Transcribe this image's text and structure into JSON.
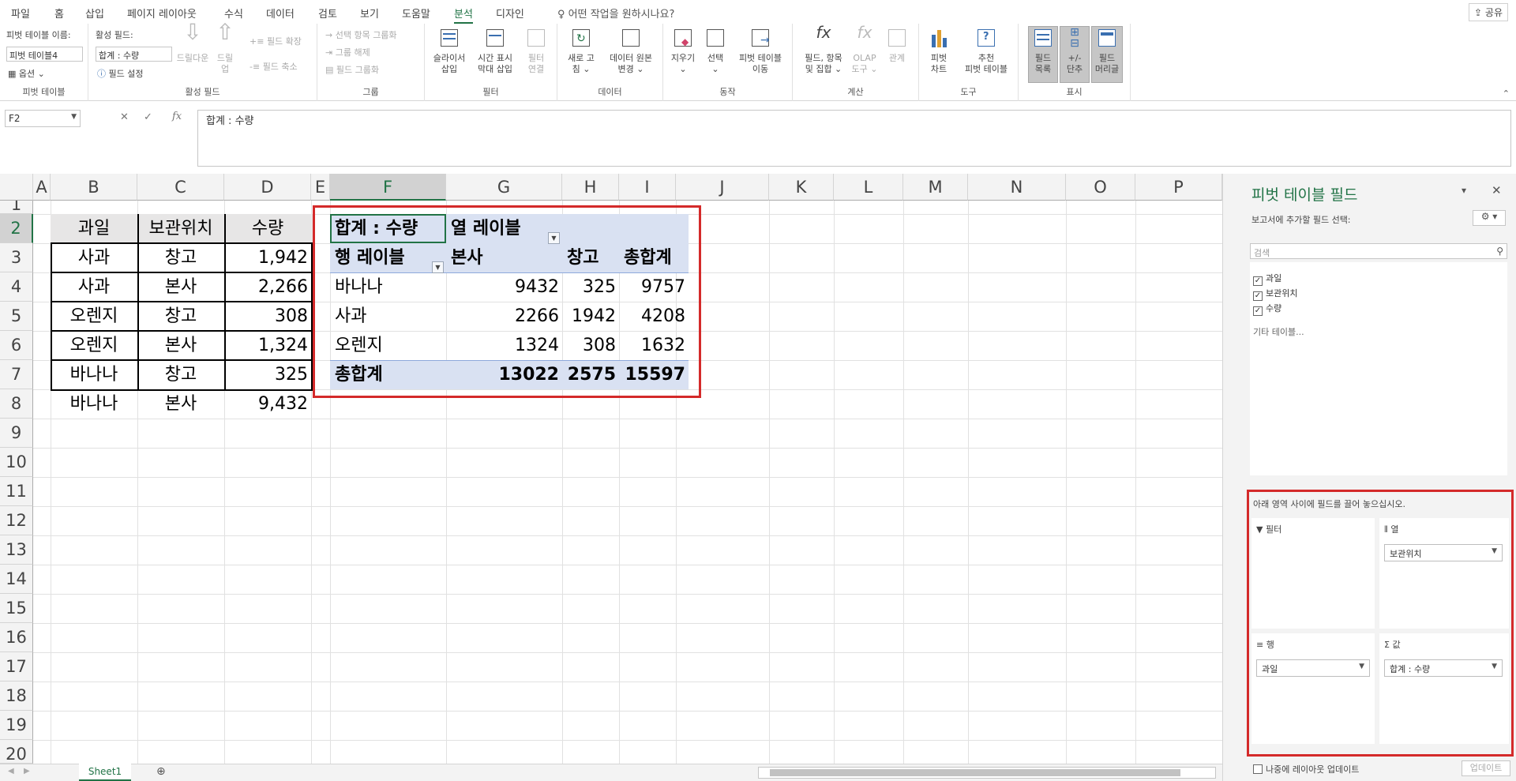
{
  "menu": {
    "items": [
      "파일",
      "홈",
      "삽입",
      "페이지 레이아웃",
      "수식",
      "데이터",
      "검토",
      "보기",
      "도움말",
      "분석",
      "디자인"
    ],
    "tell_me": "어떤 작업을 원하시나요?",
    "share": "공유"
  },
  "ribbon": {
    "pivot": {
      "name_label": "피벗 테이블 이름:",
      "name_value": "피벗 테이블4",
      "options": "옵션",
      "group": "피벗 테이블"
    },
    "active_field": {
      "label": "활성 필드:",
      "value": "합계 : 수량",
      "settings": "필드 설정",
      "drill_down": "드릴다운",
      "drill_up_1": "드릴",
      "drill_up_2": "업",
      "expand": "필드 확장",
      "collapse": "필드 축소",
      "group": "활성 필드"
    },
    "grouping": {
      "sel": "선택 항목 그룹화",
      "ungroup": "그룹 해제",
      "field": "필드 그룹화",
      "group": "그룹"
    },
    "filter": {
      "slicer_1": "슬라이서",
      "slicer_2": "삽입",
      "timeline_1": "시간 표시",
      "timeline_2": "막대 삽입",
      "conn_1": "필터",
      "conn_2": "연결",
      "group": "필터"
    },
    "data": {
      "refresh_1": "새로 고",
      "refresh_2": "침",
      "source_1": "데이터 원본",
      "source_2": "변경",
      "group": "데이터"
    },
    "actions": {
      "clear": "지우기",
      "select": "선택",
      "move_1": "피벗 테이블",
      "move_2": "이동",
      "group": "동작"
    },
    "calc": {
      "fields_1": "필드, 항목",
      "fields_2": "및 집합",
      "olap_1": "OLAP",
      "olap_2": "도구",
      "rel": "관계",
      "group": "계산"
    },
    "tools": {
      "chart_1": "피벗",
      "chart_2": "차트",
      "rec_1": "추천",
      "rec_2": "피벗 테이블",
      "group": "도구"
    },
    "show": {
      "list_1": "필드",
      "list_2": "목록",
      "btn_1": "+/-",
      "btn_2": "단추",
      "hdr_1": "필드",
      "hdr_2": "머리글",
      "group": "표시"
    }
  },
  "formula_bar": {
    "name_box": "F2",
    "content": "합계 : 수량"
  },
  "columns": [
    "A",
    "B",
    "C",
    "D",
    "E",
    "F",
    "G",
    "H",
    "I",
    "J",
    "K",
    "L",
    "M",
    "N",
    "O",
    "P"
  ],
  "rows": [
    "1",
    "2",
    "3",
    "4",
    "5",
    "6",
    "7",
    "8",
    "9",
    "10",
    "11",
    "12",
    "13",
    "14",
    "15",
    "16",
    "17",
    "18",
    "19",
    "20"
  ],
  "source_table": {
    "headers": [
      "과일",
      "보관위치",
      "수량"
    ],
    "rows": [
      [
        "사과",
        "창고",
        "1,942"
      ],
      [
        "사과",
        "본사",
        "2,266"
      ],
      [
        "오렌지",
        "창고",
        "308"
      ],
      [
        "오렌지",
        "본사",
        "1,324"
      ],
      [
        "바나나",
        "창고",
        "325"
      ],
      [
        "바나나",
        "본사",
        "9,432"
      ]
    ]
  },
  "pivot_table": {
    "value_label": "합계 : 수량",
    "col_label": "열 레이블",
    "row_label": "행 레이블",
    "col_headers": [
      "본사",
      "창고",
      "총합계"
    ],
    "rows": [
      [
        "바나나",
        "9432",
        "325",
        "9757"
      ],
      [
        "사과",
        "2266",
        "1942",
        "4208"
      ],
      [
        "오렌지",
        "1324",
        "308",
        "1632"
      ]
    ],
    "total": [
      "총합계",
      "13022",
      "2575",
      "15597"
    ]
  },
  "sheet_tabs": {
    "active": "Sheet1"
  },
  "pane": {
    "title": "피벗 테이블 필드",
    "subtitle": "보고서에 추가할 필드 선택:",
    "search_placeholder": "검색",
    "fields": [
      "과일",
      "보관위치",
      "수량"
    ],
    "more_tables": "기타 테이블...",
    "drag_hint": "아래 영역 사이에 필드를 끌어 놓으십시오.",
    "areas": {
      "filter": "필터",
      "columns": "열",
      "rows": "행",
      "values": "값"
    },
    "col_field": "보관위치",
    "row_field": "과일",
    "value_field": "합계 : 수량",
    "defer_label": "나중에 레이아웃 업데이트",
    "update_button": "업데이트"
  }
}
